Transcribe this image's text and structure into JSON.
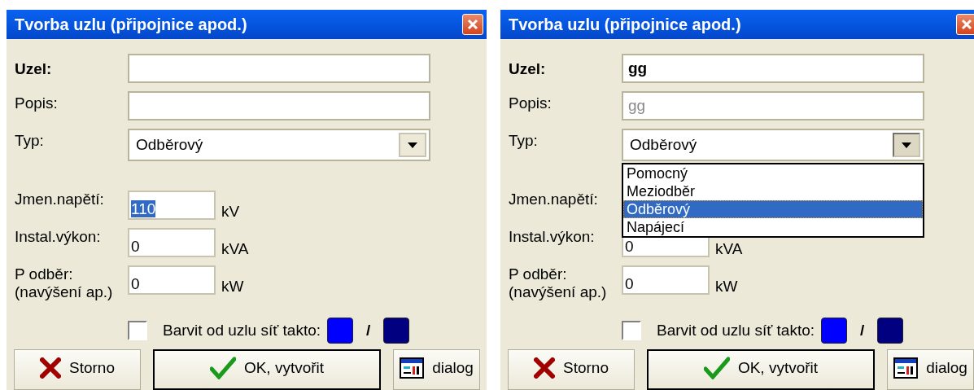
{
  "dialogs": [
    {
      "title": "Tvorba uzlu (připojnice apod.)",
      "fields": [
        {
          "kind": "name",
          "label": "Uzel:"
        },
        {
          "kind": "text",
          "label": "Popis:"
        },
        {
          "kind": "combo",
          "label": "Typ:",
          "value": "Odběrový",
          "expanded": false
        }
      ],
      "quantities": [
        {
          "label": "Jmen.napětí:",
          "value": "110",
          "value_selected": true,
          "unit": "kV"
        },
        {
          "label": "Instal.výkon:",
          "value": "0",
          "value_selected": false,
          "unit": "kVA"
        },
        {
          "label": "P odběr:\n(navýšení ap.)",
          "value": "0",
          "value_selected": false,
          "unit": "kW"
        }
      ],
      "coloring": {
        "label": "Barvit od uzlu síť takto:",
        "checked": false,
        "separator": "/",
        "colors": [
          {
            "color": "#0000ff"
          },
          {
            "color": "#000080"
          }
        ]
      },
      "buttons": [
        {
          "kind": "cancel",
          "label": "Storno",
          "default": false
        },
        {
          "kind": "ok",
          "label": "OK, vytvořit",
          "default": true
        },
        {
          "kind": "dialog",
          "label": "dialog",
          "default": false
        }
      ]
    },
    {
      "title": "Tvorba uzlu (připojnice apod.)",
      "fields": [
        {
          "kind": "name",
          "label": "Uzel:",
          "value": "gg"
        },
        {
          "kind": "text",
          "label": "Popis:",
          "placeholder": "gg"
        },
        {
          "kind": "combo",
          "label": "Typ:",
          "value": "Odběrový",
          "expanded": true,
          "options": [
            {
              "label": "Pomocný",
              "selected": false
            },
            {
              "label": "Meziodběr",
              "selected": false
            },
            {
              "label": "Odběrový",
              "selected": true
            },
            {
              "label": "Napájecí",
              "selected": false
            }
          ]
        }
      ],
      "quantities": [
        {
          "label": "Jmen.napětí:"
        },
        {
          "label": "Instal.výkon:",
          "value": "0",
          "value_selected": false,
          "unit": "kVA"
        },
        {
          "label": "P odběr:\n(navýšení ap.)",
          "value": "0",
          "value_selected": false,
          "unit": "kW"
        }
      ],
      "coloring": {
        "label": "Barvit od uzlu síť takto:",
        "checked": false,
        "separator": "/",
        "colors": [
          {
            "color": "#0000ff"
          },
          {
            "color": "#000080"
          }
        ]
      },
      "buttons": [
        {
          "kind": "cancel",
          "label": "Storno",
          "default": false
        },
        {
          "kind": "ok",
          "label": "OK, vytvořit",
          "default": true
        },
        {
          "kind": "dialog",
          "label": "dialog",
          "default": false
        }
      ]
    }
  ]
}
